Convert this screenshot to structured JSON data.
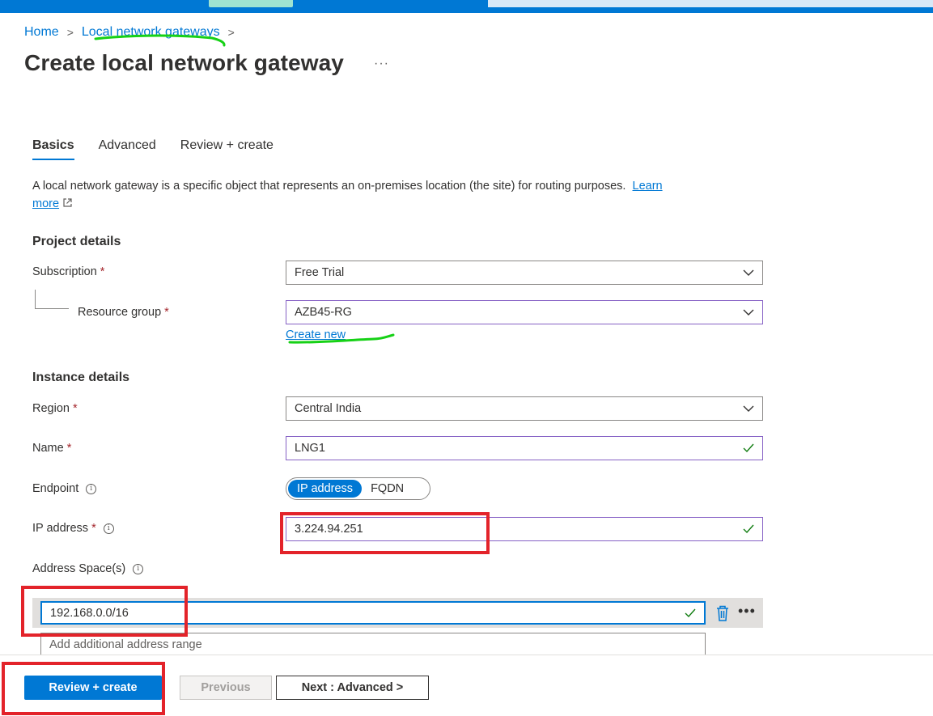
{
  "breadcrumb": {
    "home": "Home",
    "parent": "Local network gateways",
    "sep": ">"
  },
  "title": "Create local network gateway",
  "title_more": "···",
  "tabs": [
    {
      "label": "Basics",
      "active": true
    },
    {
      "label": "Advanced",
      "active": false
    },
    {
      "label": "Review + create",
      "active": false
    }
  ],
  "description": {
    "text": "A local network gateway is a specific object that represents an on-premises location (the site) for routing purposes.",
    "learn": "Learn",
    "more": "more"
  },
  "project_details": {
    "heading": "Project details",
    "subscription_label": "Subscription",
    "subscription_value": "Free Trial",
    "resource_group_label": "Resource group",
    "resource_group_value": "AZB45-RG",
    "create_new": "Create new"
  },
  "instance_details": {
    "heading": "Instance details",
    "region_label": "Region",
    "region_value": "Central India",
    "name_label": "Name",
    "name_value": "LNG1",
    "endpoint_label": "Endpoint",
    "endpoint_options": [
      "IP address",
      "FQDN"
    ],
    "endpoint_selected": "IP address",
    "ip_label": "IP address",
    "ip_value": "3.224.94.251",
    "address_space_label": "Address Space(s)",
    "address_space_value": "192.168.0.0/16",
    "address_add_placeholder": "Add additional address range"
  },
  "required_mark": "*",
  "info_glyph": "i",
  "footer": {
    "review_create": "Review + create",
    "previous": "Previous",
    "next": "Next : Advanced >"
  },
  "colors": {
    "accent": "#0078d4",
    "annotation_red": "#e3232a",
    "annotation_green": "#16d116",
    "valid_check": "#107c10",
    "focused_border": "#8661c5"
  }
}
